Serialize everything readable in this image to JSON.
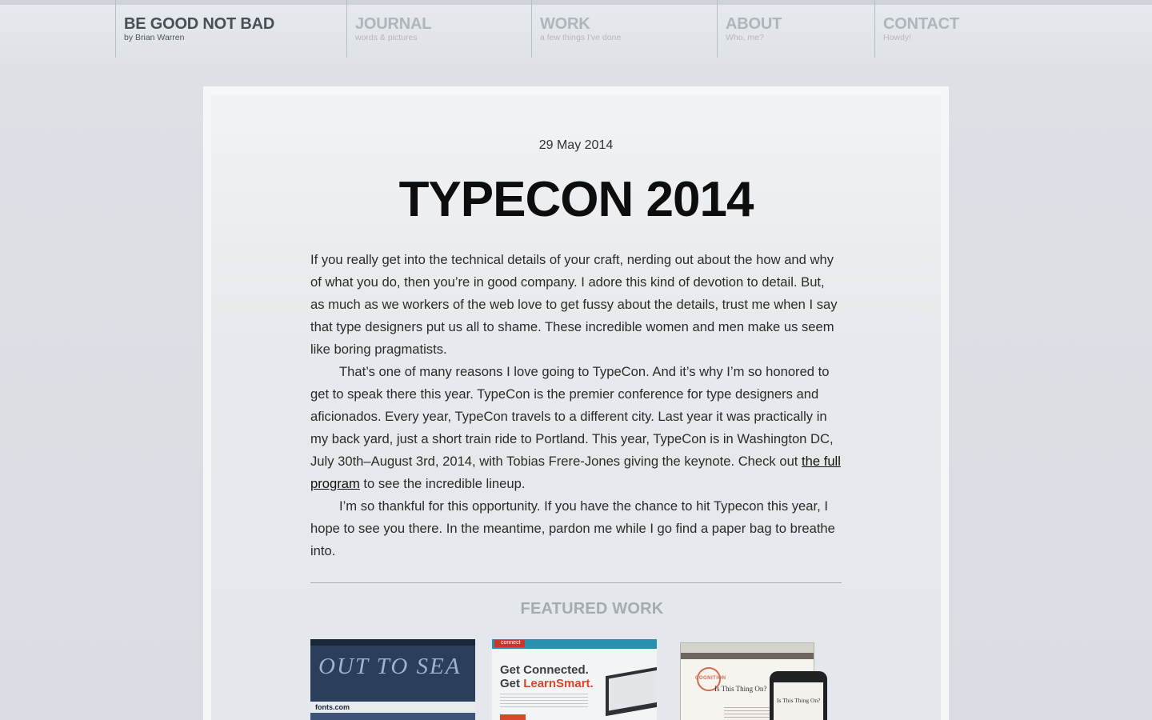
{
  "nav": {
    "brand": {
      "title": "BE GOOD NOT BAD",
      "subtitle": "by Brian Warren"
    },
    "items": [
      {
        "title": "JOURNAL",
        "subtitle": "words & pictures"
      },
      {
        "title": "WORK",
        "subtitle": "a few things I've done"
      },
      {
        "title": "ABOUT",
        "subtitle": "Who, me?"
      },
      {
        "title": "CONTACT",
        "subtitle": "Howdy!"
      }
    ]
  },
  "post": {
    "date": "29 May 2014",
    "title": "TYPECON 2014",
    "paragraphs": {
      "p1": "If you really get into the technical details of your craft, nerding out about the how and why of what you do, then you’re in good company. I adore this kind of devotion to detail. But, as much as we workers of the web love to get fussy about the details, trust me when I say that type designers put us all to shame. These incredible women and men make us seem like boring pragmatists.",
      "p2_before": "That’s one of many reasons I love going to TypeCon. And it’s why I’m so honored to get to speak there this year. TypeCon is the premier conference for type designers and aficionados. Every year, TypeCon travels to a different city. Last year it was practically in my back yard, just a short train ride to Portland. This year, TypeCon is in Washington DC, July 30th–August 3rd, 2014, with Tobias Frere-Jones giving the keynote. Check out ",
      "p2_link": "the full program",
      "p2_after": " to see the incredible lineup.",
      "p3": "I’m so thankful for this opportunity. If you have the chance to hit Typecon this year, I hope to see you there. In the meantime, pardon me while I go find a paper bag to breathe into."
    }
  },
  "featured": {
    "heading": "FEATURED WORK",
    "thumbs": {
      "t1": {
        "headline": "OUT TO SEA",
        "site": "fonts.com"
      },
      "t2": {
        "brand": "connect",
        "line1": "Get Connected.",
        "line2_a": "Get ",
        "line2_b": "LearnSmart."
      },
      "t3": {
        "logo": "COGNITION",
        "title": "Is This Thing On?",
        "phone_title": "Is This Thing On?"
      }
    }
  },
  "colors": {
    "background": "#dde1e6",
    "card": "#f6f7f8",
    "title": "#0d0d0d",
    "nav_inactive": "#b0b5bb",
    "nav_brand": "#4a4f56",
    "accent_orange": "#d8472b"
  }
}
